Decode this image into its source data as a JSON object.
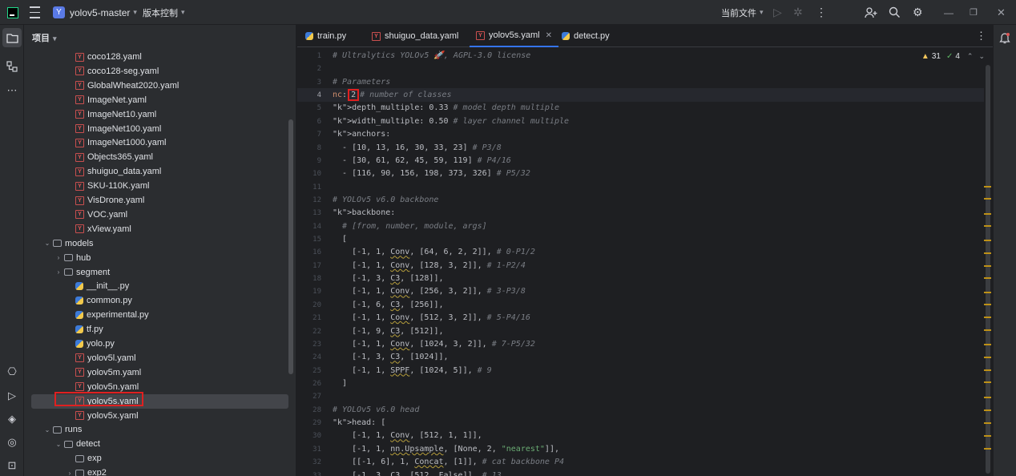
{
  "titlebar": {
    "project_initial": "Y",
    "project_name": "yolov5-master",
    "vcs_label": "版本控制",
    "run_config": "当前文件"
  },
  "project_panel": {
    "title": "项目",
    "items": [
      {
        "name": "coco128.yaml",
        "type": "yaml",
        "indent": 3
      },
      {
        "name": "coco128-seg.yaml",
        "type": "yaml",
        "indent": 3
      },
      {
        "name": "GlobalWheat2020.yaml",
        "type": "yaml",
        "indent": 3
      },
      {
        "name": "ImageNet.yaml",
        "type": "yaml",
        "indent": 3
      },
      {
        "name": "ImageNet10.yaml",
        "type": "yaml",
        "indent": 3
      },
      {
        "name": "ImageNet100.yaml",
        "type": "yaml",
        "indent": 3
      },
      {
        "name": "ImageNet1000.yaml",
        "type": "yaml",
        "indent": 3
      },
      {
        "name": "Objects365.yaml",
        "type": "yaml",
        "indent": 3
      },
      {
        "name": "shuiguo_data.yaml",
        "type": "yaml",
        "indent": 3
      },
      {
        "name": "SKU-110K.yaml",
        "type": "yaml",
        "indent": 3
      },
      {
        "name": "VisDrone.yaml",
        "type": "yaml",
        "indent": 3
      },
      {
        "name": "VOC.yaml",
        "type": "yaml",
        "indent": 3
      },
      {
        "name": "xView.yaml",
        "type": "yaml",
        "indent": 3
      },
      {
        "name": "models",
        "type": "folder",
        "indent": 1,
        "expanded": true
      },
      {
        "name": "hub",
        "type": "folder",
        "indent": 2,
        "expanded": false
      },
      {
        "name": "segment",
        "type": "folder",
        "indent": 2,
        "expanded": false
      },
      {
        "name": "__init__.py",
        "type": "py",
        "indent": 3
      },
      {
        "name": "common.py",
        "type": "py",
        "indent": 3
      },
      {
        "name": "experimental.py",
        "type": "py",
        "indent": 3
      },
      {
        "name": "tf.py",
        "type": "py",
        "indent": 3
      },
      {
        "name": "yolo.py",
        "type": "py",
        "indent": 3
      },
      {
        "name": "yolov5l.yaml",
        "type": "yaml",
        "indent": 3
      },
      {
        "name": "yolov5m.yaml",
        "type": "yaml",
        "indent": 3
      },
      {
        "name": "yolov5n.yaml",
        "type": "yaml",
        "indent": 3
      },
      {
        "name": "yolov5s.yaml",
        "type": "yaml",
        "indent": 3,
        "selected": true
      },
      {
        "name": "yolov5x.yaml",
        "type": "yaml",
        "indent": 3
      },
      {
        "name": "runs",
        "type": "folder",
        "indent": 1,
        "expanded": true
      },
      {
        "name": "detect",
        "type": "folder",
        "indent": 2,
        "expanded": true
      },
      {
        "name": "exp",
        "type": "folder",
        "indent": 3
      },
      {
        "name": "exp2",
        "type": "folder",
        "indent": 3,
        "expanded": false
      }
    ]
  },
  "tabs": [
    {
      "label": "train.py",
      "type": "py"
    },
    {
      "label": "shuiguo_data.yaml",
      "type": "yaml"
    },
    {
      "label": "yolov5s.yaml",
      "type": "yaml",
      "active": true
    },
    {
      "label": "detect.py",
      "type": "py"
    }
  ],
  "inspection": {
    "warnings": "31",
    "ok": "4"
  },
  "editor": {
    "current_line": 4,
    "lines": [
      "# Ultralytics YOLOv5 🚀, AGPL-3.0 license",
      "",
      "# Parameters",
      "nc: 2 # number of classes",
      "depth_multiple: 0.33 # model depth multiple",
      "width_multiple: 0.50 # layer channel multiple",
      "anchors:",
      "  - [10, 13, 16, 30, 33, 23] # P3/8",
      "  - [30, 61, 62, 45, 59, 119] # P4/16",
      "  - [116, 90, 156, 198, 373, 326] # P5/32",
      "",
      "# YOLOv5 v6.0 backbone",
      "backbone:",
      "  # [from, number, module, args]",
      "  [",
      "    [-1, 1, Conv, [64, 6, 2, 2]], # 0-P1/2",
      "    [-1, 1, Conv, [128, 3, 2]], # 1-P2/4",
      "    [-1, 3, C3, [128]],",
      "    [-1, 1, Conv, [256, 3, 2]], # 3-P3/8",
      "    [-1, 6, C3, [256]],",
      "    [-1, 1, Conv, [512, 3, 2]], # 5-P4/16",
      "    [-1, 9, C3, [512]],",
      "    [-1, 1, Conv, [1024, 3, 2]], # 7-P5/32",
      "    [-1, 3, C3, [1024]],",
      "    [-1, 1, SPPF, [1024, 5]], # 9",
      "  ]",
      "",
      "# YOLOv5 v6.0 head",
      "head: [",
      "    [-1, 1, Conv, [512, 1, 1]],",
      "    [-1, 1, nn.Upsample, [None, 2, \"nearest\"]],",
      "    [[-1, 6], 1, Concat, [1]], # cat backbone P4",
      "    [-1, 3, C3, [512, False]], # 13"
    ]
  }
}
